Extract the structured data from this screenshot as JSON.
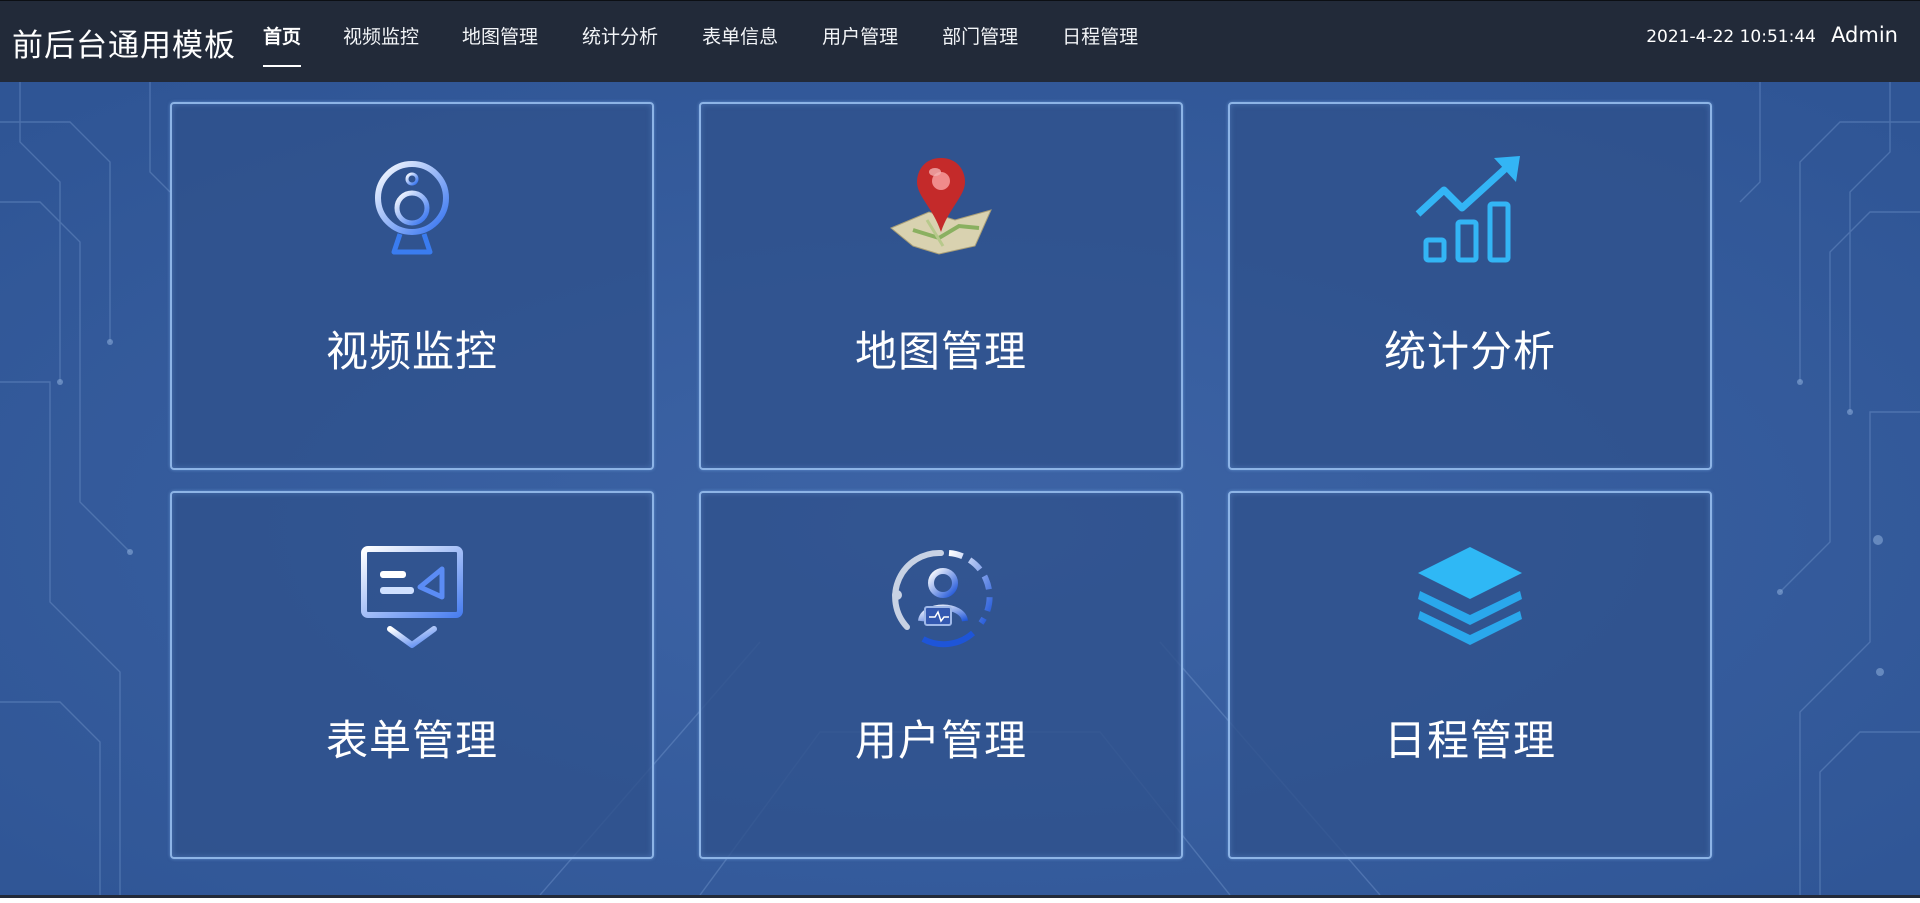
{
  "header": {
    "app_title": "前后台通用模板",
    "nav": [
      {
        "label": "首页",
        "active": true
      },
      {
        "label": "视频监控"
      },
      {
        "label": "地图管理"
      },
      {
        "label": "统计分析"
      },
      {
        "label": "表单信息"
      },
      {
        "label": "用户管理"
      },
      {
        "label": "部门管理"
      },
      {
        "label": "日程管理"
      }
    ],
    "datetime": "2021-4-22 10:51:44",
    "user": "Admin"
  },
  "cards": [
    {
      "label": "视频监控",
      "icon": "webcam-icon"
    },
    {
      "label": "地图管理",
      "icon": "map-pin-icon"
    },
    {
      "label": "统计分析",
      "icon": "chart-trend-icon"
    },
    {
      "label": "表单管理",
      "icon": "presentation-board-icon"
    },
    {
      "label": "用户管理",
      "icon": "user-monitor-icon"
    },
    {
      "label": "日程管理",
      "icon": "layers-icon"
    }
  ],
  "colors": {
    "topbar": "#222a39",
    "background": "#3a60a0",
    "card_border": "#8db4e6",
    "icon_blue": "#33b5f5"
  }
}
